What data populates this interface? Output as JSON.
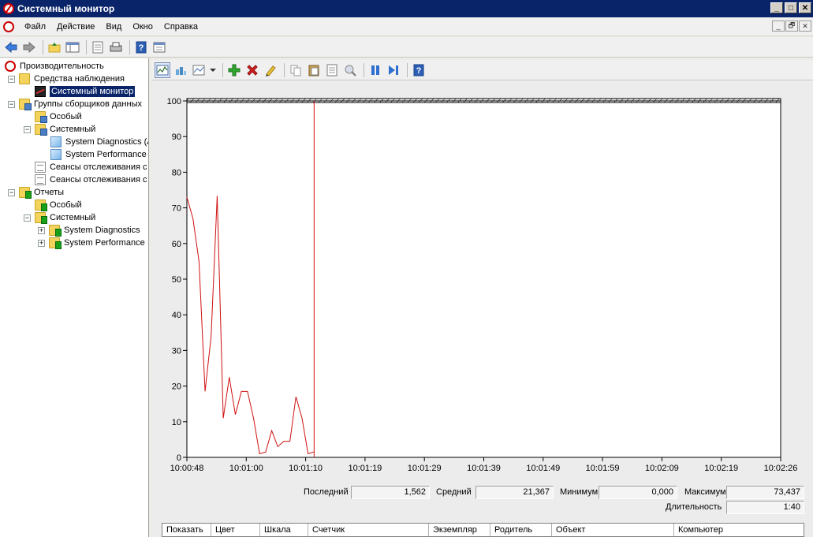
{
  "window": {
    "title": "Системный монитор",
    "controls": [
      "_",
      "□",
      "✕"
    ]
  },
  "menu": {
    "items": [
      "Файл",
      "Действие",
      "Вид",
      "Окно",
      "Справка"
    ],
    "mdi_controls": [
      "_",
      "🗗",
      "✕"
    ]
  },
  "toolbar": {
    "icons": [
      "back-icon",
      "forward-icon",
      "up-folder-icon",
      "show-hide-tree-icon",
      "export-list-icon",
      "print-icon",
      "help-icon",
      "properties-icon"
    ]
  },
  "tree": {
    "items": [
      {
        "label": "Производительность",
        "icon": "perf-root-icon",
        "expander": ""
      },
      {
        "label": "Средства наблюдения",
        "icon": "folder-icon",
        "expander": "−"
      },
      {
        "label": "Системный монитор",
        "icon": "system-monitor-icon",
        "expander": "",
        "selected": true
      },
      {
        "label": "Группы сборщиков данных",
        "icon": "folder-icon",
        "expander": "−"
      },
      {
        "label": "Особый",
        "icon": "folder-icon",
        "expander": ""
      },
      {
        "label": "Системный",
        "icon": "folder-icon",
        "expander": "−"
      },
      {
        "label": "System Diagnostics (A",
        "icon": "data-collector-icon",
        "expander": ""
      },
      {
        "label": "System Performance (",
        "icon": "data-collector-icon",
        "expander": ""
      },
      {
        "label": "Сеансы отслеживания с",
        "icon": "task-list-icon",
        "expander": ""
      },
      {
        "label": "Сеансы отслеживания с",
        "icon": "task-list-icon",
        "expander": ""
      },
      {
        "label": "Отчеты",
        "icon": "reports-folder-icon",
        "expander": "−"
      },
      {
        "label": "Особый",
        "icon": "report-icon",
        "expander": ""
      },
      {
        "label": "Системный",
        "icon": "report-icon",
        "expander": "−"
      },
      {
        "label": "System Diagnostics",
        "icon": "report-folder-icon",
        "expander": "+"
      },
      {
        "label": "System Performance",
        "icon": "report-folder-icon",
        "expander": "+"
      }
    ]
  },
  "chart_toolbar": {
    "icons": [
      "view-graph-icon",
      "view-histogram-icon",
      "change-graph-type-icon",
      "add-counter-icon",
      "delete-counter-icon",
      "highlight-icon",
      "copy-properties-icon",
      "paste-counter-list-icon",
      "properties-icon",
      "zoom-icon",
      "freeze-display-icon",
      "update-data-icon",
      "help-icon"
    ]
  },
  "chart_data": {
    "type": "line",
    "title": "",
    "xlabel": "",
    "ylabel": "",
    "ylim": [
      0,
      100
    ],
    "yticks": [
      0,
      10,
      20,
      30,
      40,
      50,
      60,
      70,
      80,
      90,
      100
    ],
    "xticks": [
      "10:00:48",
      "10:01:00",
      "10:01:10",
      "10:01:19",
      "10:01:29",
      "10:01:39",
      "10:01:49",
      "10:01:59",
      "10:02:09",
      "10:02:19",
      "10:02:26"
    ],
    "x_range_seconds": [
      0,
      98
    ],
    "grid": false,
    "current_time_marker_seconds": 21,
    "series": [
      {
        "color": "#d01010",
        "x": [
          0,
          1,
          2,
          3,
          4,
          5,
          6,
          7,
          8,
          9,
          10,
          11,
          12,
          13,
          14,
          15,
          16,
          17,
          18,
          19,
          20,
          21
        ],
        "values": [
          73,
          67,
          55,
          18.5,
          34,
          73.4,
          11,
          22.5,
          12,
          18.5,
          18.5,
          11,
          1,
          1.5,
          7.5,
          3,
          4.5,
          4.5,
          17,
          11,
          1,
          1.562
        ]
      }
    ]
  },
  "stats": {
    "last_label": "Последний",
    "last_value": "1,562",
    "average_label": "Средний",
    "average_value": "21,367",
    "minimum_label": "Минимум",
    "minimum_value": "0,000",
    "maximum_label": "Максимум",
    "maximum_value": "73,437",
    "duration_label": "Длительность",
    "duration_value": "1:40"
  },
  "legend": {
    "columns": [
      "Показать",
      "Цвет",
      "Шкала",
      "Счетчик",
      "Экземпляр",
      "Родитель",
      "Объект",
      "Компьютер"
    ]
  }
}
